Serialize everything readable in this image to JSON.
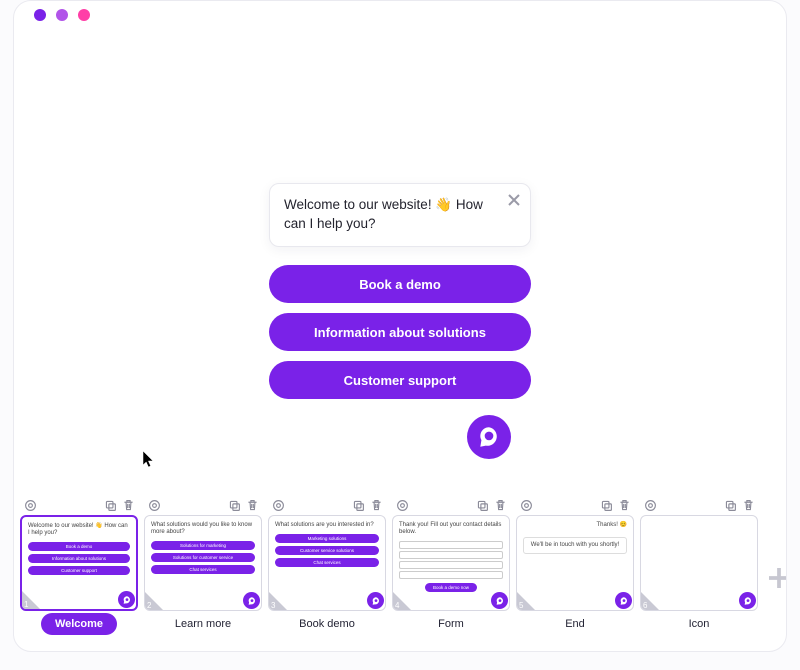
{
  "chat": {
    "message": "Welcome to our website! 👋 How can I help you?",
    "options": [
      {
        "label": "Book a demo"
      },
      {
        "label": "Information about solutions"
      },
      {
        "label": "Customer support"
      }
    ]
  },
  "slides": [
    {
      "num": "1",
      "label": "Welcome",
      "selected": true,
      "preview_header": "Welcome to our website! 👋 How can I help you?",
      "preview_buttons": [
        "Book a demo",
        "Information about solutions",
        "Customer support"
      ],
      "type": "buttons"
    },
    {
      "num": "2",
      "label": "Learn more",
      "selected": false,
      "preview_header": "What solutions would you like to know more about?",
      "preview_buttons": [
        "Solutions for marketing",
        "Solutions for customer service",
        "Chat services"
      ],
      "type": "buttons"
    },
    {
      "num": "3",
      "label": "Book demo",
      "selected": false,
      "preview_header": "What solutions are you interested in?",
      "preview_buttons": [
        "Marketing solutions",
        "Customer service solutions",
        "Chat services"
      ],
      "type": "buttons"
    },
    {
      "num": "4",
      "label": "Form",
      "selected": false,
      "preview_header": "Thank you! Fill out your contact details below.",
      "type": "form"
    },
    {
      "num": "5",
      "label": "End",
      "selected": false,
      "preview_header": "Thanks! 😊",
      "preview_sub": "We'll be in touch with you shortly!",
      "type": "end"
    },
    {
      "num": "6",
      "label": "Icon",
      "selected": false,
      "type": "icon"
    }
  ]
}
